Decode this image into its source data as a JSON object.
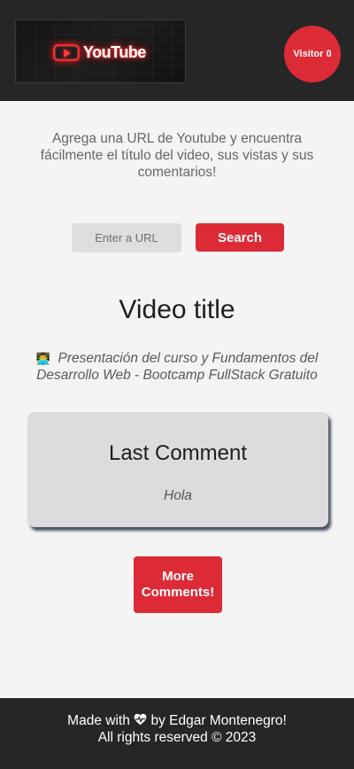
{
  "header": {
    "logo_text": "YouTube",
    "visitor_label": "Visitor 0"
  },
  "main": {
    "intro": "Agrega una URL de Youtube y encuentra fácilmente el título del video, sus vistas y sus comentarios!",
    "url_placeholder": "Enter a URL",
    "search_label": "Search",
    "video_title_heading": "Video title",
    "video_emoji": "👨‍💻",
    "video_name": "Presentación del curso y Fundamentos del Desarrollo Web - Bootcamp FullStack Gratuito",
    "comment_heading": "Last Comment",
    "comment_text": "Hola",
    "more_label": "More Comments!"
  },
  "footer": {
    "line1_before": "Made with",
    "line1_after": "by Edgar Montenegro!",
    "line2": "All rights reserved © 2023"
  },
  "colors": {
    "accent": "#dc2b37",
    "dark": "#262626",
    "background": "#f4f4f4"
  },
  "icons": {
    "logo": "youtube-neon-logo",
    "footer": "heart-icon"
  }
}
